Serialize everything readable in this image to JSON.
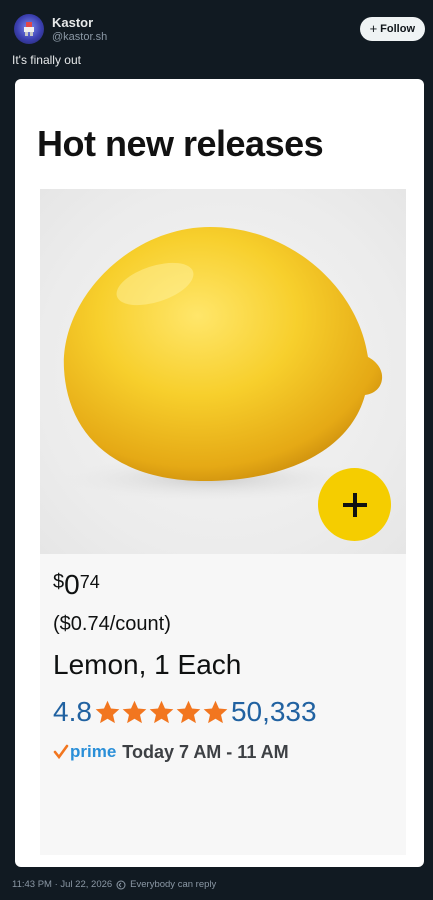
{
  "post": {
    "author_name": "Kastor",
    "author_handle": "@kastor.sh",
    "follow_label": "Follow",
    "text": "It's finally out",
    "timestamp": "11:43 PM · Jul 22, 2026",
    "reply_setting": "Everybody can reply"
  },
  "media": {
    "title": "Hot new releases",
    "product": {
      "price_symbol": "$",
      "price_whole": "0",
      "price_cents": "74",
      "unit_price": "($0.74/count)",
      "name": "Lemon, 1 Each",
      "rating": "4.8",
      "rating_stars": 5,
      "review_count": "50,333",
      "prime_label": "prime",
      "delivery": "Today 7 AM - 11 AM"
    }
  },
  "colors": {
    "page_bg": "#111a22",
    "add_button": "#f5cd00",
    "star": "#f2761f",
    "link_blue": "#2162a1",
    "prime_blue": "#2a8fd8"
  },
  "icons": {
    "avatar": "avatar-icon",
    "add": "plus-icon",
    "star": "star-icon",
    "prime": "checkmark-icon",
    "reply": "reply-settings-icon"
  }
}
